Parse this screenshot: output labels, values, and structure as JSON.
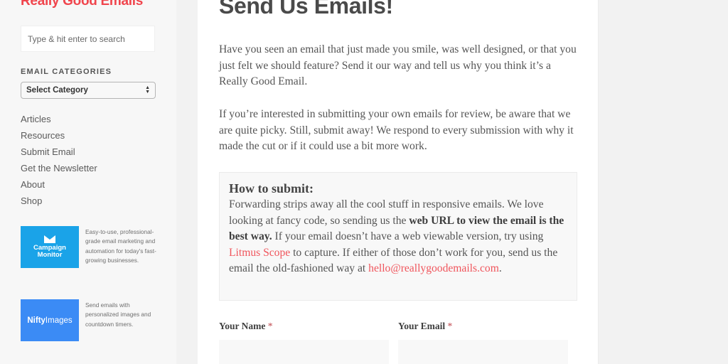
{
  "sidebar": {
    "site_title": "Really Good Emails",
    "search": {
      "placeholder": "Type & hit enter to search",
      "value": ""
    },
    "categories_heading": "EMAIL CATEGORIES",
    "category_select": {
      "selected": "Select Category"
    },
    "nav": [
      {
        "label": "Articles"
      },
      {
        "label": "Resources"
      },
      {
        "label": "Submit Email"
      },
      {
        "label": "Get the Newsletter"
      },
      {
        "label": "About"
      },
      {
        "label": "Shop"
      }
    ],
    "ads": [
      {
        "brand_line1": "Campaign",
        "brand_line2": "Monitor",
        "description": "Easy-to-use, professional-grade email marketing and automation for today's fast-growing businesses.",
        "color": "#1aa3e8",
        "icon": "envelope-icon"
      },
      {
        "brand_bold": "Nifty",
        "brand_light": "Images",
        "description": "Send emails with personalized images and countdown timers.",
        "color": "#3b8bf5"
      }
    ]
  },
  "main": {
    "title": "Send Us Emails!",
    "paragraph1": "Have you seen an email that just made you smile, was well designed, or that you just felt we should feature? Send it our way and tell us why you think it’s a Really Good Email.",
    "paragraph2": "If you’re interested in submitting your own emails for review, be aware that we are quite picky. Still, submit away! We respond to every submission with why it made the cut or if it could use a bit more work.",
    "how_to": {
      "title": "How to submit:",
      "text1": "Forwarding strips away all the cool stuff in responsive emails. We love looking at fancy code, so sending us the ",
      "bold": "web URL to view the email is the best way.",
      "text2": " If your email doesn’t have a web viewable version, try using ",
      "link1": "Litmus Scope",
      "text3": " to capture. If either of those don’t work for you, send us the email the old-fashioned way at ",
      "link2": "hello@reallygoodemails.com",
      "text4": "."
    },
    "form": {
      "name_label": "Your Name",
      "email_label": "Your Email",
      "required_marker": "*",
      "name_value": "",
      "email_value": ""
    }
  },
  "colors": {
    "brand_red": "#f0454d",
    "link": "#f0555c"
  }
}
